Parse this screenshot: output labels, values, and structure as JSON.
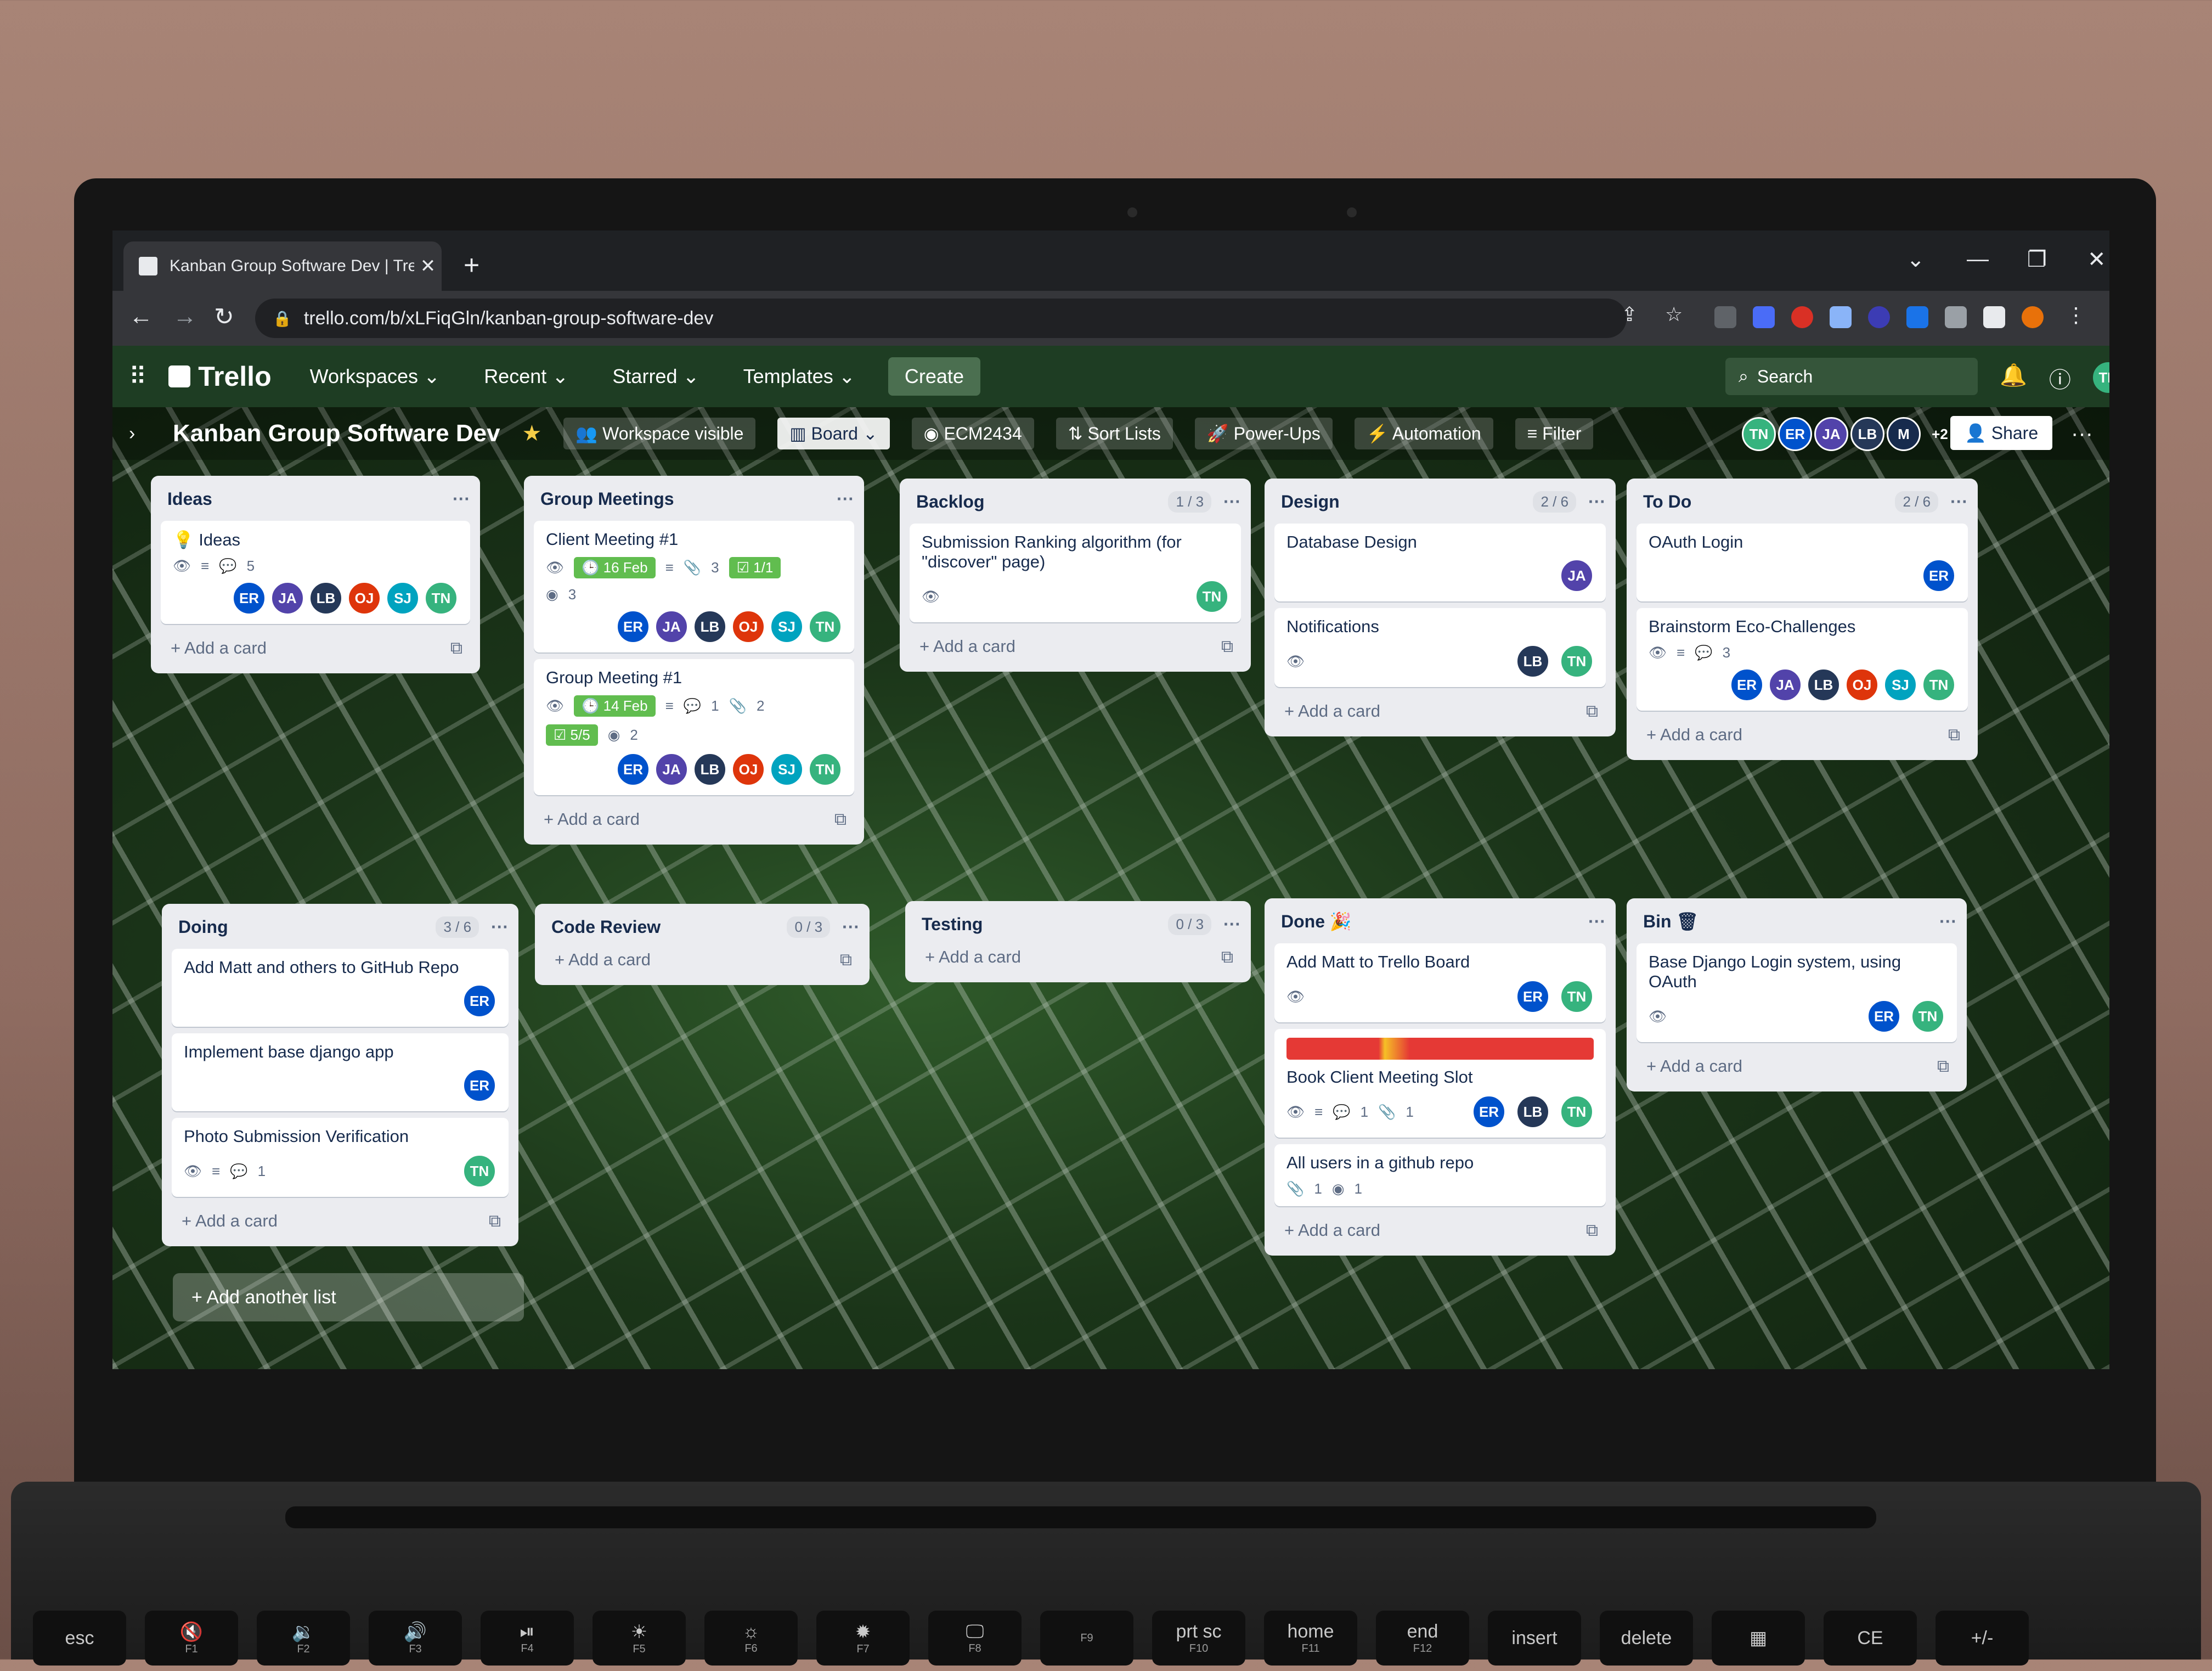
{
  "browser": {
    "tab_title": "Kanban Group Software Dev | Tre",
    "tab_close": "✕",
    "new_tab": "+",
    "url": "trello.com/b/xLFiqGln/kanban-group-software-dev",
    "controls": [
      "⌄",
      "—",
      "❐",
      "✕"
    ]
  },
  "trello_header": {
    "logo": "Trello",
    "menu": [
      "Workspaces ⌄",
      "Recent ⌄",
      "Starred ⌄",
      "Templates ⌄"
    ],
    "create": "Create",
    "search_placeholder": "Search",
    "user_initials": "TN"
  },
  "board_header": {
    "title": "Kanban Group Software Dev",
    "visibility": "Workspace visible",
    "view": "Board",
    "github": "ECM2434",
    "sort": "Sort Lists",
    "powerups": "Power-Ups",
    "automation": "Automation",
    "filter": "Filter",
    "members": [
      "TN",
      "ER",
      "JA",
      "LB",
      "M",
      "+2"
    ],
    "share": "Share"
  },
  "lists": {
    "ideas": {
      "name": "Ideas",
      "card1": {
        "title": "Ideas",
        "comments": "5"
      }
    },
    "group_meetings": {
      "name": "Group Meetings",
      "card1": {
        "title": "Client Meeting #1",
        "due": "16 Feb",
        "attach": "3",
        "check": "1/1",
        "github": "3"
      },
      "card2": {
        "title": "Group Meeting #1",
        "due": "14 Feb",
        "comments": "1",
        "attach": "2",
        "check": "5/5",
        "github": "2"
      }
    },
    "backlog": {
      "name": "Backlog",
      "limit": "1 / 3",
      "card1": {
        "title": "Submission Ranking algorithm (for \"discover\" page)"
      }
    },
    "design": {
      "name": "Design",
      "limit": "2 / 6",
      "card1": {
        "title": "Database Design"
      },
      "card2": {
        "title": "Notifications"
      }
    },
    "todo": {
      "name": "To Do",
      "limit": "2 / 6",
      "card1": {
        "title": "OAuth Login"
      },
      "card2": {
        "title": "Brainstorm Eco-Challenges",
        "comments": "3"
      }
    },
    "doing": {
      "name": "Doing",
      "limit": "3 / 6",
      "card1": {
        "title": "Add Matt and others to GitHub Repo"
      },
      "card2": {
        "title": "Implement base django app"
      },
      "card3": {
        "title": "Photo Submission Verification",
        "comments": "1"
      }
    },
    "code_review": {
      "name": "Code Review",
      "limit": "0 / 3"
    },
    "testing": {
      "name": "Testing",
      "limit": "0 / 3"
    },
    "done": {
      "name": "Done 🎉",
      "card1": {
        "title": "Add Matt to Trello Board"
      },
      "card2": {
        "title": "Book Client Meeting Slot",
        "comments": "1",
        "attach": "1"
      },
      "card3": {
        "title": "All users in a github repo",
        "attach": "1",
        "github": "1"
      }
    },
    "bin": {
      "name": "Bin 🗑",
      "card1": {
        "title": "Base Django Login system, using OAuth"
      }
    }
  },
  "add_card_label": "+ Add a card",
  "add_list_label": "+ Add another list",
  "keyboard": [
    {
      "main": "esc",
      "sub": ""
    },
    {
      "main": "🔇",
      "sub": "F1"
    },
    {
      "main": "🔉",
      "sub": "F2"
    },
    {
      "main": "🔊",
      "sub": "F3"
    },
    {
      "main": "⏯",
      "sub": "F4"
    },
    {
      "main": "☀",
      "sub": "F5"
    },
    {
      "main": "☼",
      "sub": "F6"
    },
    {
      "main": "✹",
      "sub": "F7"
    },
    {
      "main": "🖵",
      "sub": "F8"
    },
    {
      "main": "",
      "sub": "F9"
    },
    {
      "main": "prt sc",
      "sub": "F10"
    },
    {
      "main": "home",
      "sub": "F11"
    },
    {
      "main": "end",
      "sub": "F12"
    },
    {
      "main": "insert",
      "sub": ""
    },
    {
      "main": "delete",
      "sub": ""
    },
    {
      "main": "▦",
      "sub": ""
    },
    {
      "main": "CE",
      "sub": ""
    },
    {
      "main": "+/-",
      "sub": ""
    }
  ],
  "colors": {
    "trello_header": "#1e3d23",
    "list_bg": "#ebecf0",
    "due_green": "#61bd4f"
  }
}
